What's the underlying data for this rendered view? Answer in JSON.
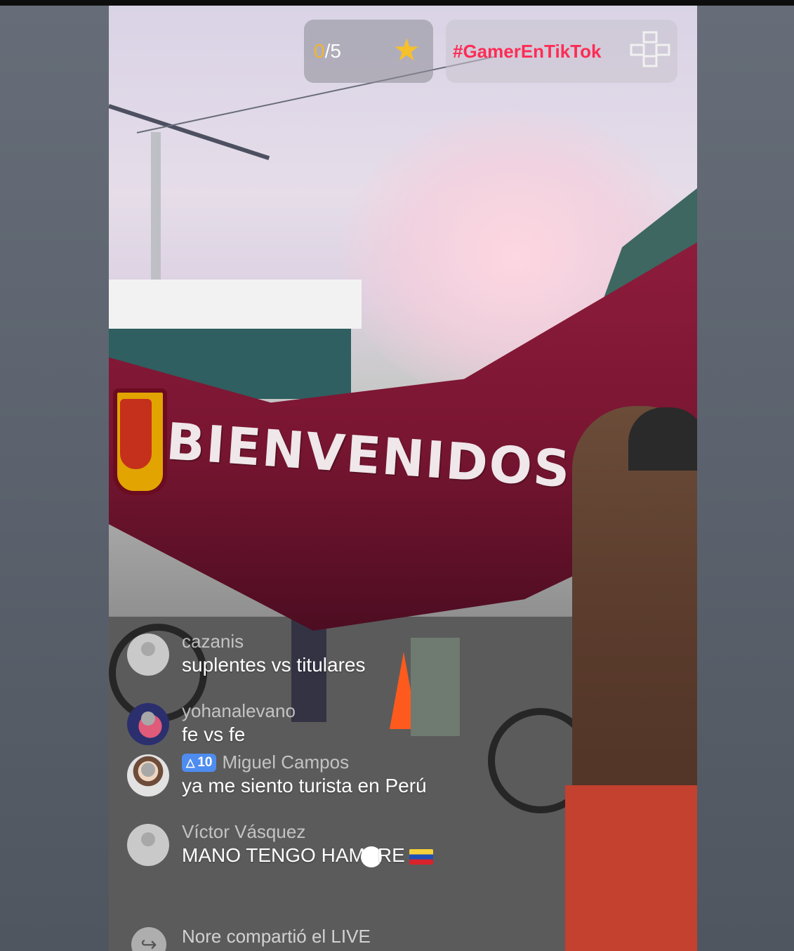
{
  "goal": {
    "current": "0",
    "total": "/5",
    "icon": "star-icon"
  },
  "hashtag": {
    "label": "#GamerEnTikTok",
    "icon": "game-controller-icon"
  },
  "banner": {
    "text": "BIENVENIDOS A CASA"
  },
  "comments": [
    {
      "user": "cazanis",
      "message": "suplentes vs titulares"
    },
    {
      "user": "yohanalevano",
      "message": "fe vs fe"
    },
    {
      "user": "Miguel Campos",
      "badge_level": "10",
      "message": "ya me siento turista en Perú"
    },
    {
      "user": "Víctor Vásquez",
      "message_part1": "MANO TENGO HAM",
      "message_part2": "RE"
    }
  ],
  "share": {
    "text": "Nore compartió el LIVE"
  },
  "colors": {
    "hashtag": "#fe2c55",
    "goal_current": "#f6b42a",
    "badge": "#4e8cf0"
  }
}
